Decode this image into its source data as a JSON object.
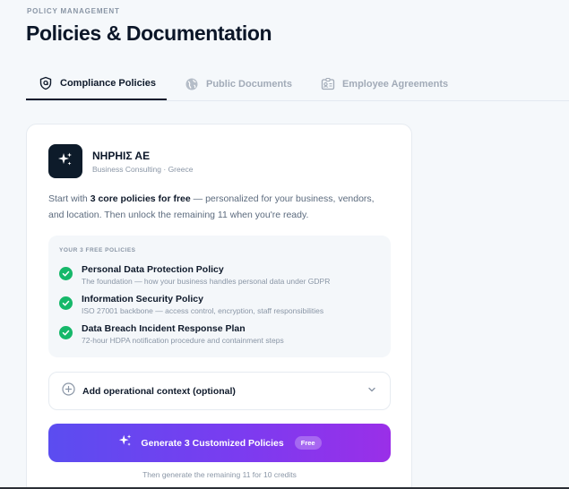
{
  "header": {
    "eyebrow": "POLICY MANAGEMENT",
    "title": "Policies & Documentation"
  },
  "tabs": [
    {
      "label": "Compliance Policies",
      "icon": "shield-icon",
      "active": true
    },
    {
      "label": "Public Documents",
      "icon": "globe-icon",
      "active": false
    },
    {
      "label": "Employee Agreements",
      "icon": "id-card-icon",
      "active": false
    }
  ],
  "org": {
    "logo_icon": "sparkles-icon",
    "name": "ΝΗΡΗΙΣ ΑΕ",
    "meta": "Business Consulting · Greece"
  },
  "intro": {
    "prefix": "Start with ",
    "bold": "3 core policies for free",
    "suffix": " — personalized for your business, vendors, and location. Then unlock the remaining 11 when you're ready."
  },
  "free_policies": {
    "heading": "YOUR 3 FREE POLICIES",
    "items": [
      {
        "title": "Personal Data Protection Policy",
        "desc": "The foundation — how your business handles personal data under GDPR"
      },
      {
        "title": "Information Security Policy",
        "desc": "ISO 27001 backbone — access control, encryption, staff responsibilities"
      },
      {
        "title": "Data Breach Incident Response Plan",
        "desc": "72-hour HDPA notification procedure and containment steps"
      }
    ]
  },
  "context": {
    "label": "Add operational context (optional)"
  },
  "generate": {
    "label": "Generate 3 Customized Policies",
    "badge": "Free"
  },
  "footnote": "Then generate the remaining 11 for 10 credits",
  "colors": {
    "accent_start": "#5b4df0",
    "accent_end": "#9a2fe8",
    "success": "#16b86a",
    "dark": "#0d1b2a"
  }
}
